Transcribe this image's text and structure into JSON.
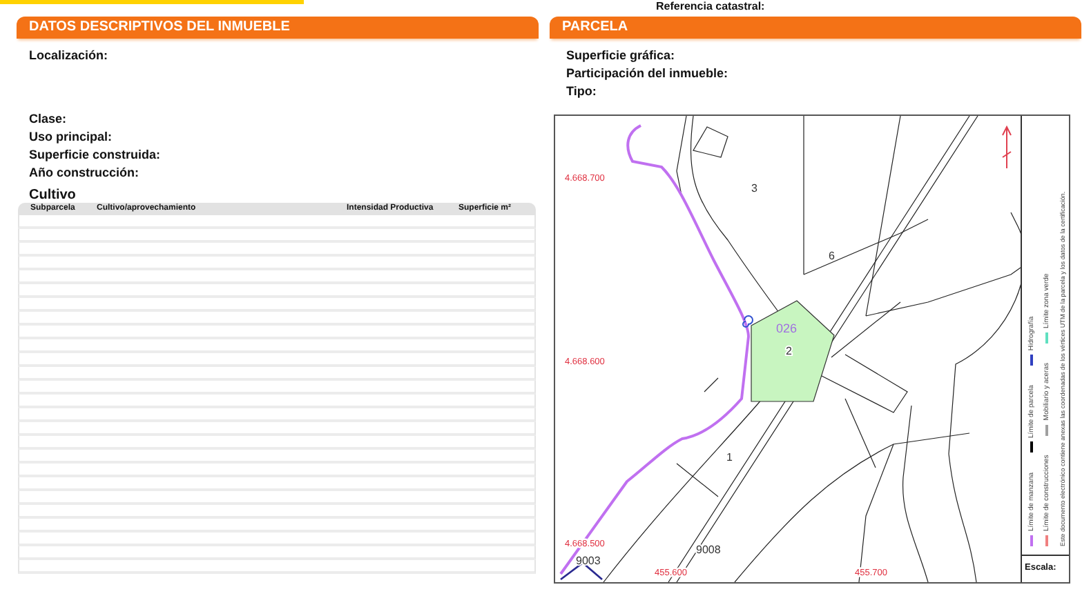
{
  "top_strip": {
    "caption": "Referencia catastral:"
  },
  "left_panel": {
    "title": "DATOS DESCRIPTIVOS DEL INMUEBLE",
    "localizacion": "Localización:",
    "fields": [
      "Clase:",
      "Uso principal:",
      "Superficie construida:",
      "Año construcción:"
    ],
    "cultivo": {
      "title": "Cultivo",
      "columns": [
        "Subparcela",
        "Cultivo/aprovechamiento",
        "Intensidad Productiva",
        "Superficie m²"
      ]
    }
  },
  "right_panel": {
    "title": "PARCELA",
    "fields": [
      "Superficie gráfica:",
      "Participación del inmueble:",
      "Tipo:"
    ],
    "map": {
      "parcel_label": "026",
      "subparcel_labels": [
        {
          "text": "3"
        },
        {
          "text": "6"
        },
        {
          "text": "2"
        },
        {
          "text": "1"
        },
        {
          "text": "9008"
        },
        {
          "text": "9003"
        }
      ],
      "y_coords": [
        "4.668.700",
        "4.668.600",
        "4.668.500"
      ],
      "x_coords": [
        "455.600",
        "455.700"
      ]
    },
    "legend": {
      "items": [
        {
          "label": "Límite de manzana",
          "color": "#c070f0"
        },
        {
          "label": "Límite de parcela",
          "color": "#000000"
        },
        {
          "label": "Hidrografía",
          "color": "#3040c0"
        },
        {
          "label": "Límite de construcciones",
          "color": "#f08080"
        },
        {
          "label": "Mobiliario y aceras",
          "color": "#a0a0a0"
        },
        {
          "label": "Límite zona verde",
          "color": "#60e0c0"
        }
      ],
      "note": "Este documento electrónico contiene anexas las coordenadas de los vértices UTM de la parcela y los datos de la certificación."
    },
    "scale_label": "Escala:"
  }
}
